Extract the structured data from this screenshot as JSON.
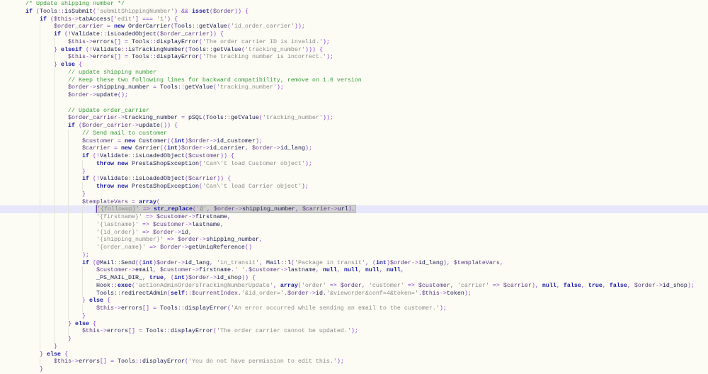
{
  "editor": {
    "current_line": 28,
    "lines": [
      {
        "indent": 0,
        "text": "/* Update shipping number */"
      },
      {
        "indent": 0,
        "text": "if (Tools::isSubmit('submitShippingNumber') && isset($order)) {"
      },
      {
        "indent": 1,
        "text": "if ($this->tabAccess['edit'] === '1') {"
      },
      {
        "indent": 2,
        "text": "$order_carrier = new OrderCarrier(Tools::getValue('id_order_carrier'));"
      },
      {
        "indent": 2,
        "text": "if (!Validate::isLoadedObject($order_carrier)) {"
      },
      {
        "indent": 3,
        "text": "$this->errors[] = Tools::displayError('The order carrier ID is invalid.');"
      },
      {
        "indent": 2,
        "text": "} elseif (!Validate::isTrackingNumber(Tools::getValue('tracking_number'))) {"
      },
      {
        "indent": 3,
        "text": "$this->errors[] = Tools::displayError('The tracking number is incorrect.');"
      },
      {
        "indent": 2,
        "text": "} else {"
      },
      {
        "indent": 3,
        "text": "// update shipping number"
      },
      {
        "indent": 3,
        "text": "// Keep these two following lines for backward compatibility, remove on 1.6 version"
      },
      {
        "indent": 3,
        "text": "$order->shipping_number = Tools::getValue('tracking_number');"
      },
      {
        "indent": 3,
        "text": "$order->update();"
      },
      {
        "indent": 3,
        "text": ""
      },
      {
        "indent": 3,
        "text": "// Update order_carrier"
      },
      {
        "indent": 3,
        "text": "$order_carrier->tracking_number = pSQL(Tools::getValue('tracking_number'));"
      },
      {
        "indent": 3,
        "text": "if ($order_carrier->update()) {"
      },
      {
        "indent": 4,
        "text": "// Send mail to customer"
      },
      {
        "indent": 4,
        "text": "$customer = new Customer((int)$order->id_customer);"
      },
      {
        "indent": 4,
        "text": "$carrier = new Carrier((int)$order->id_carrier, $order->id_lang);"
      },
      {
        "indent": 4,
        "text": "if (!Validate::isLoadedObject($customer)) {"
      },
      {
        "indent": 5,
        "text": "throw new PrestaShopException('Can\\'t load Customer object');"
      },
      {
        "indent": 4,
        "text": "}"
      },
      {
        "indent": 4,
        "text": "if (!Validate::isLoadedObject($carrier)) {"
      },
      {
        "indent": 5,
        "text": "throw new PrestaShopException('Can\\'t load Carrier object');"
      },
      {
        "indent": 4,
        "text": "}"
      },
      {
        "indent": 4,
        "text": "$templateVars = array("
      },
      {
        "indent": 5,
        "text": "'{followup}' => str_replace('@', $order->shipping_number, $carrier->url),",
        "selected": true
      },
      {
        "indent": 5,
        "text": "'{firstname}' => $customer->firstname,"
      },
      {
        "indent": 5,
        "text": "'{lastname}' => $customer->lastname,"
      },
      {
        "indent": 5,
        "text": "'{id_order}' => $order->id,"
      },
      {
        "indent": 5,
        "text": "'{shipping_number}' => $order->shipping_number,"
      },
      {
        "indent": 5,
        "text": "'{order_name}' => $order->getUniqReference()"
      },
      {
        "indent": 4,
        "text": ");"
      },
      {
        "indent": 4,
        "text": "if (@Mail::Send((int)$order->id_lang, 'in_transit', Mail::l('Package in transit', (int)$order->id_lang), $templateVars,"
      },
      {
        "indent": 5,
        "text": "$customer->email, $customer->firstname.' '.$customer->lastname, null, null, null, null,"
      },
      {
        "indent": 5,
        "text": "_PS_MAIL_DIR_, true, (int)$order->id_shop)) {"
      },
      {
        "indent": 5,
        "text": "Hook::exec('actionAdminOrdersTrackingNumberUpdate', array('order' => $order, 'customer' => $customer, 'carrier' => $carrier), null, false, true, false, $order->id_shop);"
      },
      {
        "indent": 5,
        "text": "Tools::redirectAdmin(self::$currentIndex.'&id_order='.$order->id.'&vieworder&conf=4&token='.$this->token);"
      },
      {
        "indent": 4,
        "text": "} else {"
      },
      {
        "indent": 5,
        "text": "$this->errors[] = Tools::displayError('An error occurred while sending an email to the customer.');"
      },
      {
        "indent": 4,
        "text": "}"
      },
      {
        "indent": 3,
        "text": "} else {"
      },
      {
        "indent": 4,
        "text": "$this->errors[] = Tools::displayError('The order carrier cannot be updated.');"
      },
      {
        "indent": 3,
        "text": "}"
      },
      {
        "indent": 2,
        "text": "}"
      },
      {
        "indent": 1,
        "text": "} else {"
      },
      {
        "indent": 2,
        "text": "$this->errors[] = Tools::displayError('You do not have permission to edit this.');"
      },
      {
        "indent": 1,
        "text": "}"
      }
    ]
  }
}
